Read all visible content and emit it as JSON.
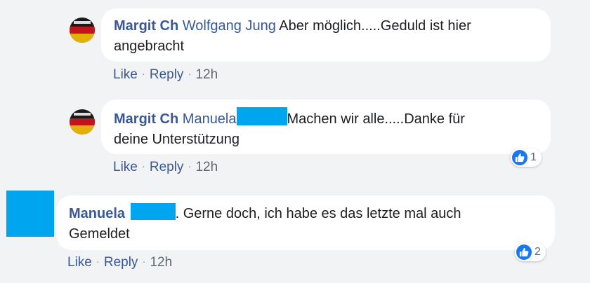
{
  "comments": [
    {
      "author": "Margit Ch",
      "mention": "Wolfgang Jung",
      "text_line1": "Aber möglich.....Geduld ist hier",
      "text_line2": "angebracht",
      "actions": {
        "like": "Like",
        "reply": "Reply",
        "time": "12h"
      }
    },
    {
      "author": "Margit Ch",
      "mention": "Manuela",
      "text_line1": "Machen wir alle.....Danke für",
      "text_line2": "deine Unterstützung",
      "actions": {
        "like": "Like",
        "reply": "Reply",
        "time": "12h"
      },
      "reaction_count": "1"
    },
    {
      "author": "Manuela",
      "text_line1": ". Gerne doch, ich habe es das letzte mal auch",
      "text_line2": "Gemeldet",
      "actions": {
        "like": "Like",
        "reply": "Reply",
        "time": "12h"
      },
      "reaction_count": "2"
    }
  ],
  "separator": "·",
  "colors": {
    "link": "#385898",
    "redaction": "#00a5f0",
    "like_blue": "#1877f2",
    "background": "#f2f3f5"
  },
  "icons": {
    "avatar": "avatar",
    "like_reaction": "thumbs-up-icon"
  }
}
